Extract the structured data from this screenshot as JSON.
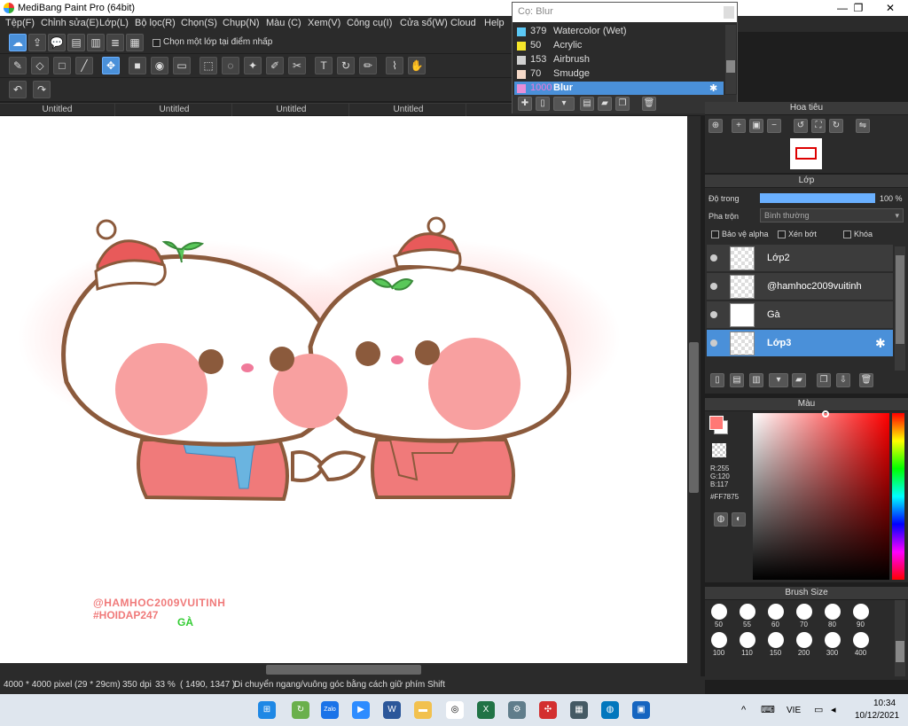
{
  "window": {
    "title": "MediBang Paint Pro (64bit)",
    "minimize": "—",
    "restore": "❐",
    "close": "✕"
  },
  "menu": [
    "Tệp(F)",
    "Chỉnh sửa(E)",
    "Lớp(L)",
    "Bộ lọc(R)",
    "Chọn(S)",
    "Chụp(N)",
    "Màu (C)",
    "Xem(V)",
    "Công cụ(I)",
    "Cửa sổ(W)",
    "Cloud",
    "Help"
  ],
  "toolbar1": {
    "select_layer_checkbox_label": "Chọn một lớp tại điểm nhấp"
  },
  "doc_tabs": [
    "Untitled",
    "Untitled",
    "Untitled",
    "Untitled"
  ],
  "brush_popup": {
    "search_placeholder": "Cọ: Blur",
    "items": [
      {
        "count": "379",
        "name": "Watercolor (Wet)",
        "color": "#5bc8f5"
      },
      {
        "count": "50",
        "name": "Acrylic",
        "color": "#f5e52a"
      },
      {
        "count": "153",
        "name": "Airbrush",
        "color": "#d0d0d0"
      },
      {
        "count": "70",
        "name": "Smudge",
        "color": "#f5d9c8"
      },
      {
        "count": "1000",
        "name": "Blur",
        "color": "#e78fd8",
        "selected": true
      }
    ]
  },
  "navigator": {
    "title": "Hoa tiêu"
  },
  "layers": {
    "title": "Lớp",
    "opacity_label": "Độ trong",
    "opacity_value": "100 %",
    "opacity_fraction": 1.0,
    "blend_label": "Pha trộn",
    "blend_value": "Bình thường",
    "protect_alpha": "Bảo vệ alpha",
    "clipping": "Xén bớt",
    "lock": "Khóa",
    "items": [
      {
        "name": "Lớp2",
        "selected": false
      },
      {
        "name": "@hamhoc2009vuitinh",
        "selected": false
      },
      {
        "name": "Gà",
        "selected": false
      },
      {
        "name": "Lớp3",
        "selected": true
      }
    ]
  },
  "color_panel": {
    "title": "Màu",
    "r": "R:255",
    "g": "G:120",
    "b": "B:117",
    "hex": "#FF7875",
    "current_color": "#FF7875"
  },
  "brush_size": {
    "title": "Brush Size",
    "sizes": [
      "50",
      "55",
      "60",
      "70",
      "80",
      "90",
      "100",
      "110",
      "150",
      "200",
      "300",
      "400"
    ]
  },
  "canvas_text": {
    "line1": "@HAMHOC2009VUITINH",
    "line2": "#HOIDAP247",
    "line3": "GÀ"
  },
  "status": {
    "size": "4000 * 4000 pixel",
    "cm": "(29 * 29cm)",
    "dpi": "350 dpi",
    "zoom": "33 %",
    "coords": "( 1490, 1347 )",
    "hint": "Di chuyển ngang/vuông góc bằng cách giữ phím Shift"
  },
  "taskbar": {
    "lang": "VIE",
    "time": "10:34",
    "date": "10/12/2021",
    "zalo": "Zalo",
    "word": "W",
    "excel": "X",
    "chevron": "^",
    "keyboard_glyph": "⌨"
  }
}
